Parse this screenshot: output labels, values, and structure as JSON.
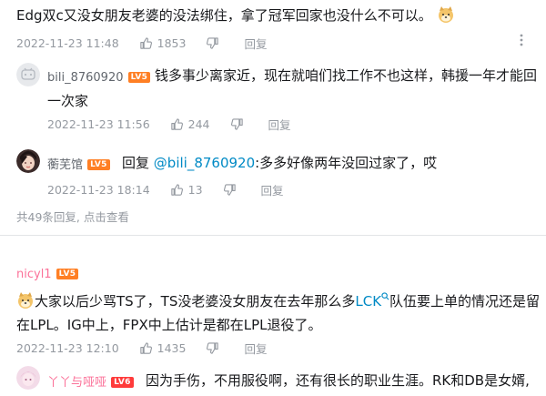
{
  "comments": [
    {
      "text": "Edg双c又没女朋友老婆的没法绑住，拿了冠军回家也没什么不可以。",
      "date": "2022-11-23 11:48",
      "likes": "1853",
      "reply_label": "回复",
      "replies": [
        {
          "username": "bili_8760920",
          "level": "LV5",
          "text_line1": "钱多事少离家近，现在就咱们找工作不也这样，韩援一年才能回",
          "text_line2": "一次家",
          "date": "2022-11-23 11:56",
          "likes": "244",
          "reply_label": "回复"
        },
        {
          "username": "蘅芜馆",
          "level": "LV5",
          "prefix": "回复",
          "mention": "@bili_8760920",
          "text": ":多多好像两年没回过家了，哎",
          "date": "2022-11-23 18:14",
          "likes": "13",
          "reply_label": "回复"
        }
      ],
      "more_replies": "共49条回复, 点击查看"
    },
    {
      "username": "nicyl1",
      "level": "LV5",
      "text_line1_a": "大家以后少骂TS了，TS没老婆没女朋友在去年那么多",
      "text_line1_link": "LCK",
      "text_line1_b": "队伍要上单的情况还是留",
      "text_line2": "在LPL。IG中上，FPX中上估计是都在LPL退役了。",
      "date": "2022-11-23 12:10",
      "likes": "1435",
      "reply_label": "回复",
      "replies": [
        {
          "username": "丫丫与哑哑",
          "level": "LV6",
          "text": "因为手伤，不用服役啊，还有很长的职业生涯。RK和DB是女婿,"
        }
      ]
    }
  ],
  "colors": {
    "link": "#008ac5",
    "level_orange": "#ff7f24",
    "level_red": "#ff3a3a",
    "meta_grey": "#9499a0"
  },
  "icons": [
    "thumb-up-icon",
    "thumb-down-icon",
    "more-vertical-icon",
    "doge-emoji-icon",
    "search-link-icon"
  ]
}
